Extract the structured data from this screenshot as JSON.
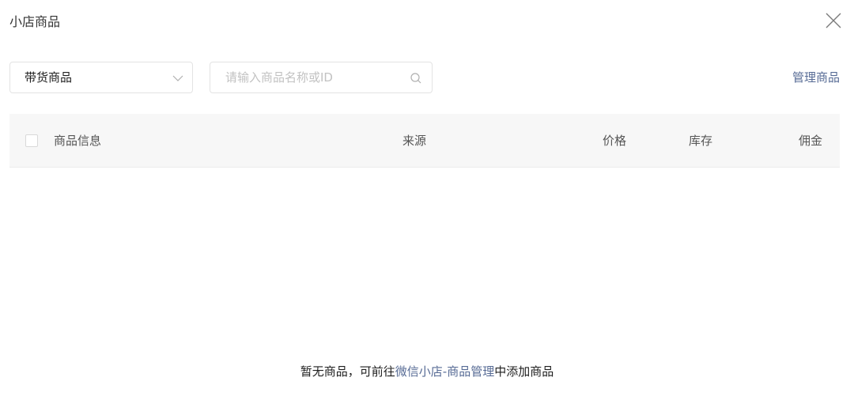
{
  "dialog": {
    "title": "小店商品"
  },
  "toolbar": {
    "filter_select": {
      "value": "带货商品"
    },
    "search": {
      "placeholder": "请输入商品名称或ID",
      "value": ""
    },
    "manage_link": "管理商品"
  },
  "table": {
    "columns": [
      "商品信息",
      "来源",
      "价格",
      "库存",
      "佣金"
    ],
    "select_all_checked": false,
    "rows": []
  },
  "empty_state": {
    "prefix": "暂无商品，可前往",
    "link": "微信小店-商品管理",
    "suffix": "中添加商品"
  },
  "colors": {
    "link": "#576b95",
    "header_bg": "#f7f7f7",
    "border": "#e3e3e3"
  },
  "icons": {
    "close": "close-icon",
    "select_arrow": "chevron-down-icon",
    "search": "search-icon"
  }
}
